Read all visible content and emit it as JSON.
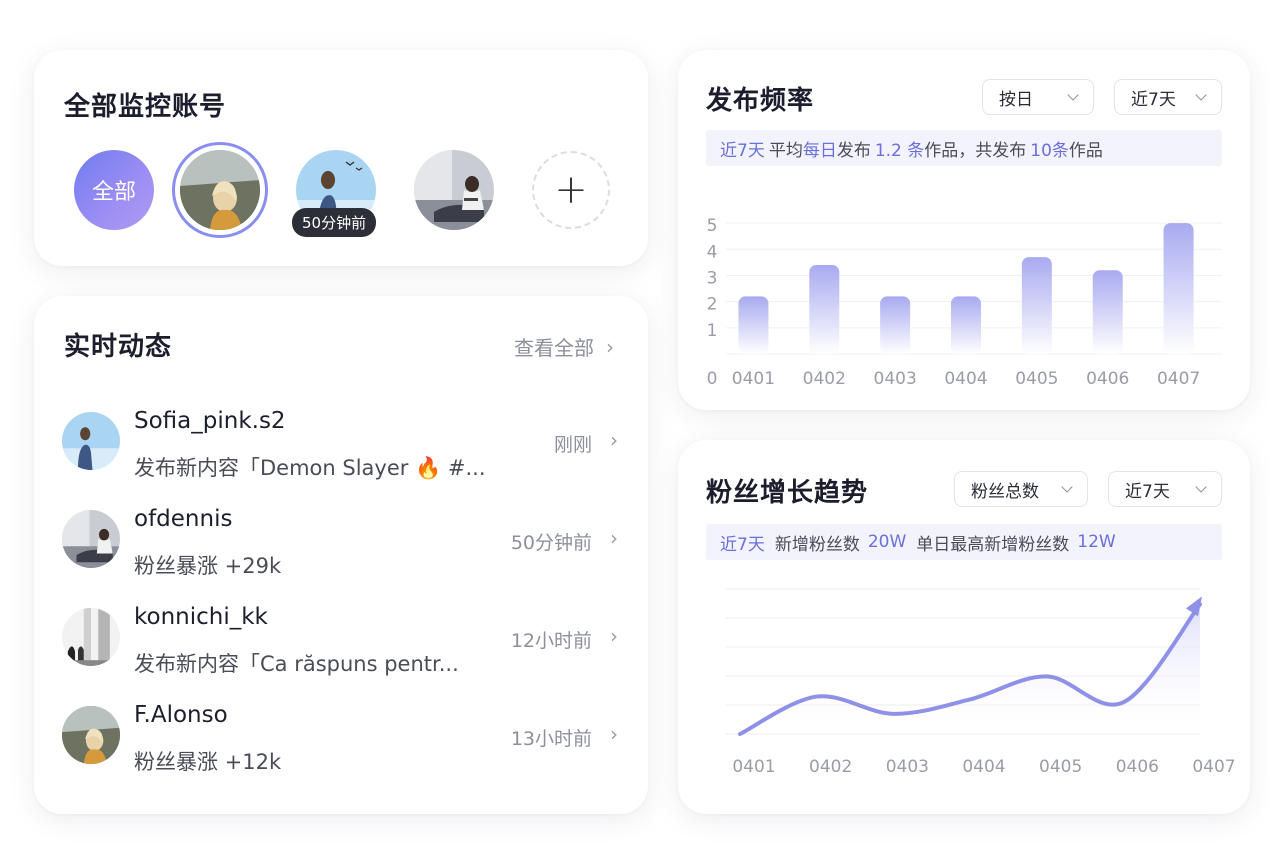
{
  "accounts": {
    "title": "全部监控账号",
    "all_label": "全部",
    "badge": "50分钟前",
    "add_label": "+"
  },
  "activity": {
    "title": "实时动态",
    "view_all": "查看全部",
    "items": [
      {
        "name": "Sofia_pink.s2",
        "desc": "发布新内容「Demon Slayer 🔥 #...",
        "time": "刚刚"
      },
      {
        "name": "ofdennis",
        "desc": "粉丝暴涨 +29k",
        "time": "50分钟前"
      },
      {
        "name": "konnichi_kk",
        "desc": "发布新内容「Ca răspuns pentr...",
        "time": "12小时前"
      },
      {
        "name": "F.Alonso",
        "desc": "粉丝暴涨 +12k",
        "time": "13小时前"
      }
    ]
  },
  "freq": {
    "title": "发布频率",
    "select_period": "按日",
    "select_range": "近7天",
    "summary": {
      "p1": "近7天",
      "p2": "平均",
      "p3": "每日",
      "p4": "发布",
      "p5": "1.2 条",
      "p6": "作品，共发布",
      "p7": "10条",
      "p8": "作品"
    }
  },
  "fans": {
    "title": "粉丝增长趋势",
    "select_metric": "粉丝总数",
    "select_range": "近7天",
    "summary": {
      "p1": "近7天",
      "p2": "新增粉丝数",
      "p3": "20W",
      "p4": "单日最高新增粉丝数",
      "p5": "12W"
    }
  },
  "colors": {
    "accent": "#7b80e8",
    "accent_light": "#f3f3fd"
  },
  "chart_data": [
    {
      "type": "bar",
      "categories": [
        "0401",
        "0402",
        "0403",
        "0404",
        "0405",
        "0406",
        "0407"
      ],
      "values": [
        2.2,
        3.4,
        2.2,
        2.2,
        3.7,
        3.2,
        5.0
      ],
      "yticks": [
        "0",
        "1",
        "2",
        "3",
        "4",
        "5"
      ],
      "ylim": [
        0,
        5.5
      ]
    },
    {
      "type": "area",
      "categories": [
        "0401",
        "0402",
        "0403",
        "0404",
        "0405",
        "0406",
        "0407"
      ],
      "values": [
        0.0,
        1.3,
        0.7,
        1.2,
        2.0,
        1.1,
        4.5
      ],
      "ylim": [
        0,
        5
      ]
    }
  ]
}
